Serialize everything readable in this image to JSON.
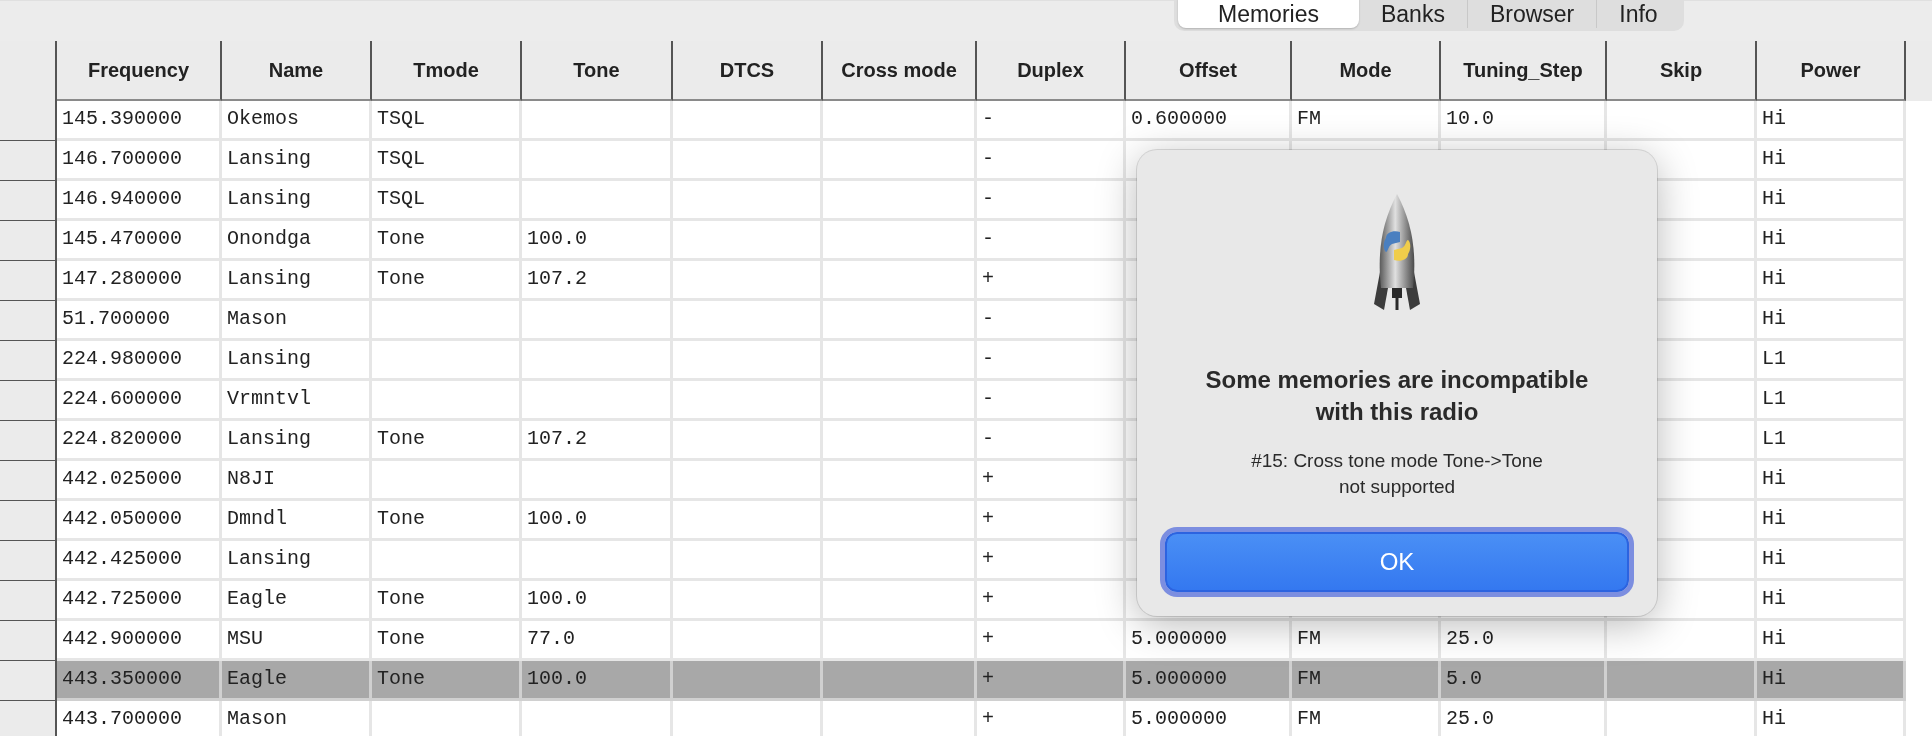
{
  "tabs": [
    {
      "label": "Memories",
      "selected": true
    },
    {
      "label": "Banks",
      "selected": false
    },
    {
      "label": "Browser",
      "selected": false
    },
    {
      "label": "Info",
      "selected": false
    }
  ],
  "table": {
    "columns": [
      "Frequency",
      "Name",
      "Tmode",
      "Tone",
      "DTCS",
      "Cross mode",
      "Duplex",
      "Offset",
      "Mode",
      "Tuning_Step",
      "Skip",
      "Power"
    ],
    "rows": [
      {
        "selected": false,
        "cells": [
          "145.390000",
          "Okemos",
          "TSQL",
          null,
          null,
          null,
          "-",
          "0.600000",
          "FM",
          "10.0",
          null,
          "Hi"
        ]
      },
      {
        "selected": false,
        "cells": [
          "146.700000",
          "Lansing",
          "TSQL",
          null,
          null,
          null,
          "-",
          null,
          null,
          null,
          null,
          "Hi"
        ]
      },
      {
        "selected": false,
        "cells": [
          "146.940000",
          "Lansing",
          "TSQL",
          null,
          null,
          null,
          "-",
          null,
          null,
          null,
          null,
          "Hi"
        ]
      },
      {
        "selected": false,
        "cells": [
          "145.470000",
          "Onondga",
          "Tone",
          "100.0",
          null,
          null,
          "-",
          null,
          null,
          null,
          null,
          "Hi"
        ]
      },
      {
        "selected": false,
        "cells": [
          "147.280000",
          "Lansing",
          "Tone",
          "107.2",
          null,
          null,
          "+",
          null,
          null,
          null,
          null,
          "Hi"
        ]
      },
      {
        "selected": false,
        "cells": [
          "51.700000",
          "Mason",
          null,
          null,
          null,
          null,
          "-",
          null,
          null,
          null,
          null,
          "Hi"
        ]
      },
      {
        "selected": false,
        "cells": [
          "224.980000",
          "Lansing",
          null,
          null,
          null,
          null,
          "-",
          null,
          null,
          null,
          null,
          "L1"
        ]
      },
      {
        "selected": false,
        "cells": [
          "224.600000",
          "Vrmntvl",
          null,
          null,
          null,
          null,
          "-",
          null,
          null,
          null,
          null,
          "L1"
        ]
      },
      {
        "selected": false,
        "cells": [
          "224.820000",
          "Lansing",
          "Tone",
          "107.2",
          null,
          null,
          "-",
          null,
          null,
          null,
          null,
          "L1"
        ]
      },
      {
        "selected": false,
        "cells": [
          "442.025000",
          "N8JI",
          null,
          null,
          null,
          null,
          "+",
          null,
          null,
          null,
          null,
          "Hi"
        ]
      },
      {
        "selected": false,
        "cells": [
          "442.050000",
          "Dmndl",
          "Tone",
          "100.0",
          null,
          null,
          "+",
          null,
          null,
          null,
          null,
          "Hi"
        ]
      },
      {
        "selected": false,
        "cells": [
          "442.425000",
          "Lansing",
          null,
          null,
          null,
          null,
          "+",
          null,
          null,
          null,
          null,
          "Hi"
        ]
      },
      {
        "selected": false,
        "cells": [
          "442.725000",
          "Eagle",
          "Tone",
          "100.0",
          null,
          null,
          "+",
          null,
          null,
          null,
          null,
          "Hi"
        ]
      },
      {
        "selected": false,
        "cells": [
          "442.900000",
          "MSU",
          "Tone",
          "77.0",
          null,
          null,
          "+",
          "5.000000",
          "FM",
          "25.0",
          null,
          "Hi"
        ]
      },
      {
        "selected": true,
        "cells": [
          "443.350000",
          "Eagle",
          "Tone",
          "100.0",
          null,
          null,
          "+",
          "5.000000",
          "FM",
          "5.0",
          null,
          "Hi"
        ]
      },
      {
        "selected": false,
        "cells": [
          "443.700000",
          "Mason",
          null,
          null,
          null,
          null,
          "+",
          "5.000000",
          "FM",
          "25.0",
          null,
          "Hi"
        ]
      }
    ]
  },
  "dialog": {
    "title": "Some memories are incompatible with this radio",
    "message": "#15: Cross tone mode Tone->Tone not supported",
    "button": "OK"
  }
}
